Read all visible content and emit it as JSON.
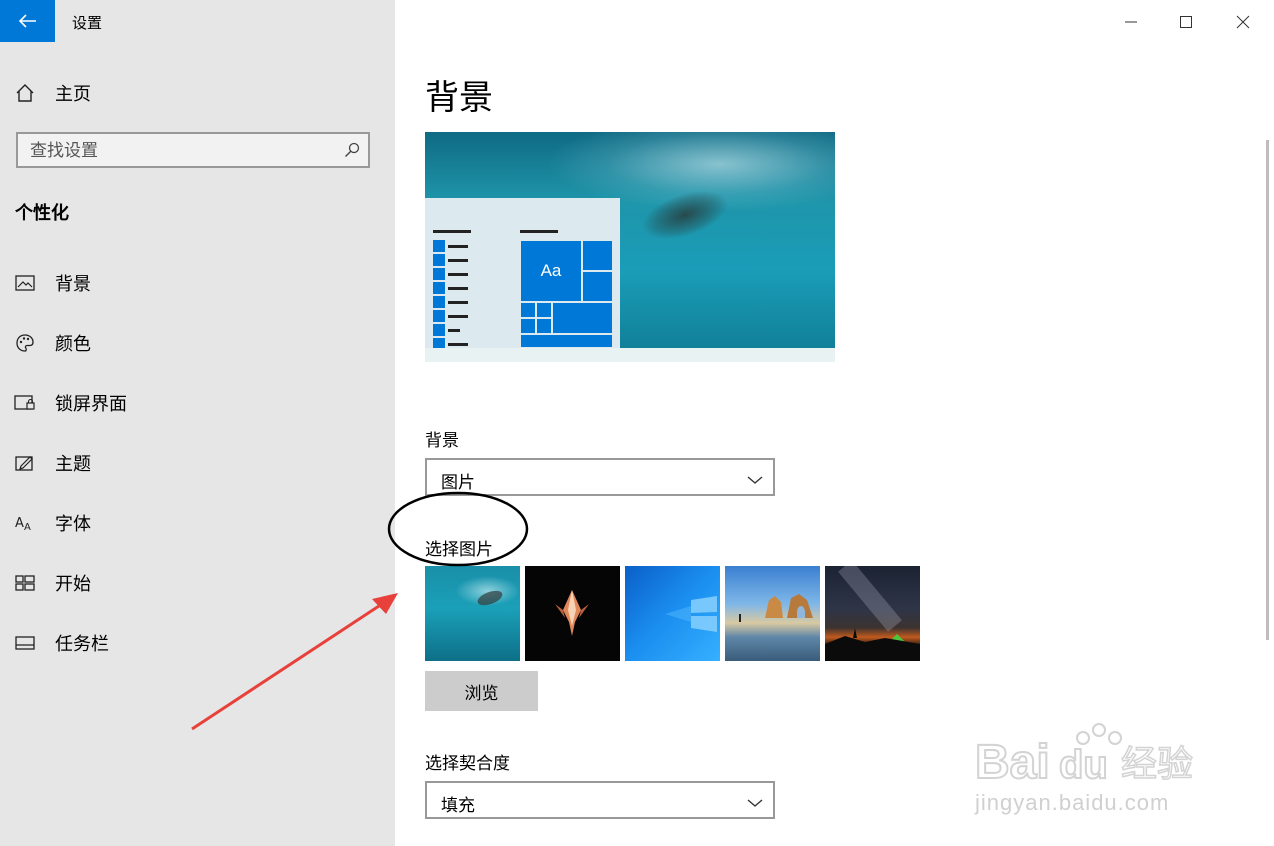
{
  "window": {
    "title": "设置",
    "minimize_glyph": "—",
    "maximize_glyph": "☐",
    "close_glyph": "✕"
  },
  "sidebar": {
    "home_label": "主页",
    "search_placeholder": "查找设置",
    "section_title": "个性化",
    "items": [
      {
        "label": "背景",
        "icon": "image-icon"
      },
      {
        "label": "颜色",
        "icon": "palette-icon"
      },
      {
        "label": "锁屏界面",
        "icon": "lock-screen-icon"
      },
      {
        "label": "主题",
        "icon": "theme-icon"
      },
      {
        "label": "字体",
        "icon": "font-icon"
      },
      {
        "label": "开始",
        "icon": "start-icon"
      },
      {
        "label": "任务栏",
        "icon": "taskbar-icon"
      }
    ]
  },
  "main": {
    "page_title": "背景",
    "preview_tile_text": "Aa",
    "background_label": "背景",
    "background_value": "图片",
    "choose_picture_label": "选择图片",
    "browse_label": "浏览",
    "fit_label": "选择契合度",
    "fit_value": "填充"
  },
  "watermark": {
    "text": "jingyan.baidu.com"
  },
  "colors": {
    "accent": "#0078d7",
    "sidebar_bg": "#e6e6e6",
    "annotation_arrow": "#e8403a"
  }
}
